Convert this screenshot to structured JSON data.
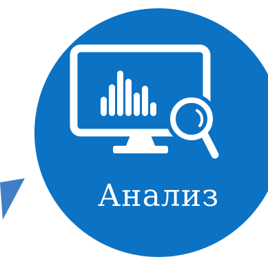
{
  "badge": {
    "label": "Анализ",
    "fill_color": "#0b72c4",
    "text_color": "#ffffff",
    "icon": "monitor-bar-chart-magnifier-icon"
  },
  "decorations": {
    "arrow_color": "#3f7fc6",
    "arrow_icon": "arrow-tip-icon"
  }
}
